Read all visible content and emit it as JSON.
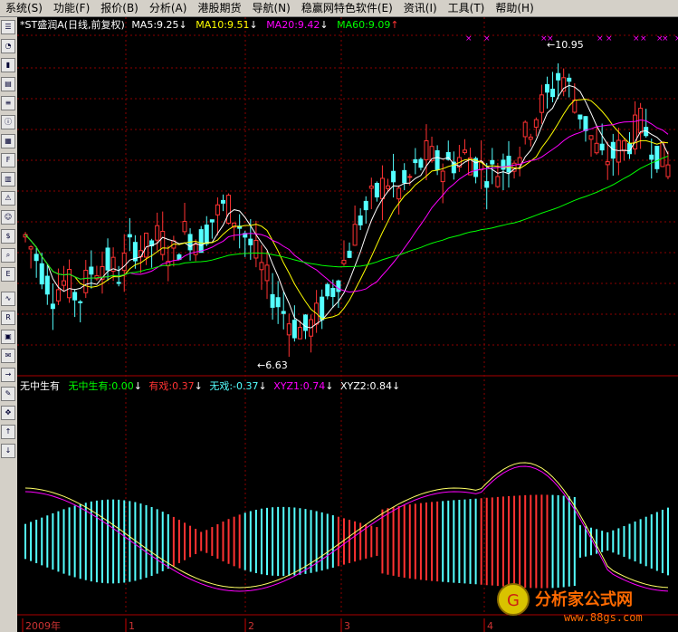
{
  "menu": [
    {
      "label": "系统(S)",
      "key": "sys"
    },
    {
      "label": "功能(F)",
      "key": "func"
    },
    {
      "label": "报价(B)",
      "key": "quote"
    },
    {
      "label": "分析(A)",
      "key": "analysis"
    },
    {
      "label": "港股期货",
      "key": "hk"
    },
    {
      "label": "导航(N)",
      "key": "nav"
    },
    {
      "label": "稳赢网特色软件(E)",
      "key": "special"
    },
    {
      "label": "资讯(I)",
      "key": "info"
    },
    {
      "label": "工具(T)",
      "key": "tools"
    },
    {
      "label": "帮助(H)",
      "key": "help"
    }
  ],
  "toolbar": [
    "quote-list-icon",
    "minute-chart-icon",
    "kline-chart-icon",
    "bar-chart-icon",
    "depth-icon",
    "info-icon",
    "report-icon",
    "f10-icon",
    "tick-icon",
    "signal-icon",
    "users-icon",
    "fund-icon",
    "search-icon",
    "etf-icon",
    "wave-icon",
    "rst-icon",
    "calc-icon",
    "news-icon",
    "exit-icon",
    "pen-icon",
    "move-icon",
    "up-arrow-icon",
    "down-arrow-icon"
  ],
  "main_legend": {
    "title": "*ST盛润A(日线,前复权)",
    "ma5": "MA5:9.25",
    "ma10": "MA10:9.51",
    "ma20": "MA20:9.42",
    "ma60": "MA60:9.09"
  },
  "annotations": {
    "high": "10.95",
    "low": "6.63"
  },
  "indicator_legend": {
    "name": "无中生有",
    "v1": "无中生有:0.00",
    "v2": "有戏:0.37",
    "v3": "无戏:-0.37",
    "v4": "XYZ1:0.74",
    "v5": "XYZ2:0.84"
  },
  "xaxis": {
    "labels": [
      "2009年",
      "1",
      "2",
      "3",
      "4"
    ]
  },
  "watermark": {
    "text": "分析家公式网",
    "url": "www.88gs.com"
  },
  "colors": {
    "up": "#ff3232",
    "down": "#54ffff",
    "ma5": "#ffffff",
    "ma10": "#ffff00",
    "ma20": "#ff00ff",
    "ma60": "#00ff00",
    "grid": "#8b0000"
  },
  "chart_data": {
    "type": "candlestick",
    "candles_approx_close": [
      8.3,
      7.9,
      7.4,
      7.6,
      7.3,
      7.8,
      7.9,
      7.7,
      8.2,
      8.1,
      8.3,
      8.0,
      8.4,
      8.2,
      8.6,
      8.8,
      8.5,
      8.1,
      7.6,
      7.2,
      6.9,
      6.8,
      7.1,
      7.5,
      8.0,
      8.6,
      8.9,
      9.2,
      9.0,
      9.3,
      9.6,
      9.4,
      9.5,
      9.6,
      9.4,
      9.3,
      9.5,
      9.7,
      10.2,
      10.5,
      10.9,
      10.5,
      10.0,
      9.5,
      9.6,
      9.8,
      10.1,
      9.7,
      9.4
    ],
    "price_range": [
      6.5,
      11.2
    ]
  }
}
